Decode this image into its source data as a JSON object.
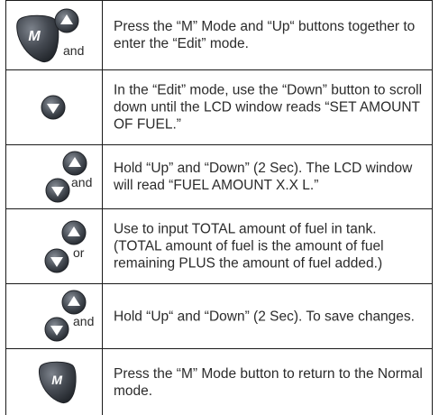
{
  "steps": [
    {
      "text": "Press the “M” Mode and “Up“ buttons together to enter the “Edit” mode.",
      "conjunction": "and",
      "icons": [
        "m-mode-button-icon",
        "up-arrow-button-icon"
      ]
    },
    {
      "text": "In the “Edit” mode, use the “Down” button to scroll down until the LCD window reads “SET AMOUNT OF FUEL.”",
      "icons": [
        "down-arrow-button-icon"
      ]
    },
    {
      "text": "Hold “Up” and “Down” (2 Sec). The LCD window will read  “FUEL AMOUNT X.X L.”",
      "conjunction": "and",
      "icons": [
        "up-arrow-button-icon",
        "down-arrow-button-icon"
      ]
    },
    {
      "text": "Use to input TOTAL amount of fuel in tank. (TOTAL amount of fuel is the amount of fuel remaining PLUS the amount of fuel added.)",
      "conjunction": "or",
      "icons": [
        "up-arrow-button-icon",
        "down-arrow-button-icon"
      ]
    },
    {
      "text": "Hold “Up“ and “Down” (2 Sec). To save changes.",
      "conjunction": "and",
      "icons": [
        "up-arrow-button-icon",
        "down-arrow-button-icon"
      ]
    },
    {
      "text": "Press the “M” Mode button to return to the Normal mode.",
      "icons": [
        "m-mode-button-icon"
      ]
    }
  ],
  "colors": {
    "button_dark": "#3a3f46",
    "button_light": "#8a9099",
    "glyph": "#ffffff",
    "rule": "#1a1a1a"
  }
}
